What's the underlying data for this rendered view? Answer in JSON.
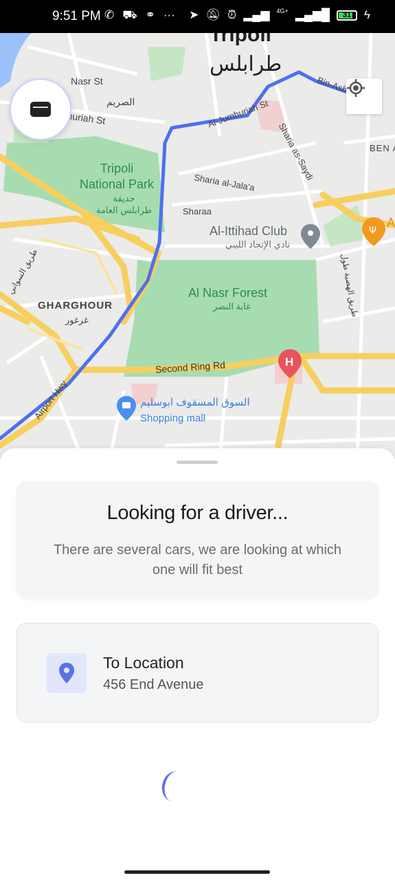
{
  "status_bar": {
    "time": "9:51 PM",
    "battery": "31",
    "network": "4G+"
  },
  "map": {
    "city_name": "Tripoli",
    "city_name_ar": "طرابلس",
    "labels": {
      "nasr_st": "Nasr St",
      "al_sarim": "الصريم",
      "al_jumhuriah_st": "Al Jumhuriah St",
      "al_jumhuriah_st_2": "Al-Jumhuriah St",
      "bin_ashour": "Bin-Ashour St",
      "sharia_as_saydi": "Sharia as-Saydi",
      "ben_a": "BEN A",
      "national_park": "Tripoli\nNational Park",
      "national_park_ar": "حديقة\nطرابلس العامة",
      "sharia_al_jalaa": "Sharia al-Jala'a",
      "sharaa": "Sharaa",
      "ittihad_club": "Al-Ittihad Club",
      "ittihad_club_ar": "نادي الإتحاد الليبي",
      "gharghour": "GHARGHOUR",
      "gharghour_ar": "غرغور",
      "al_nasr_forest": "Al Nasr Forest",
      "al_nasr_forest_ar": "غابة النصر",
      "tariq_sawani": "طريق السواني",
      "tariq_hadaba": "طريق الهضبة طول",
      "second_ring_rd": "Second Ring Rd",
      "airport_hwy": "Airport Hwy",
      "shopping_mall_ar": "السوق المسقوف ابوسليم",
      "shopping_mall": "Shopping mall",
      "restaurant_a": "A"
    },
    "colors": {
      "route": "#4f6ff0",
      "park": "#a7dcb0",
      "highway": "#f6cf5f",
      "hospital": "#e9545b",
      "poi_blue": "#4a8ff0",
      "restaurant": "#f29a1f"
    }
  },
  "sheet": {
    "status_title": "Looking for a driver...",
    "status_desc": "There are several cars, we are looking at which one will fit best",
    "destination_label": "To Location",
    "destination_address": "456 End Avenue"
  }
}
